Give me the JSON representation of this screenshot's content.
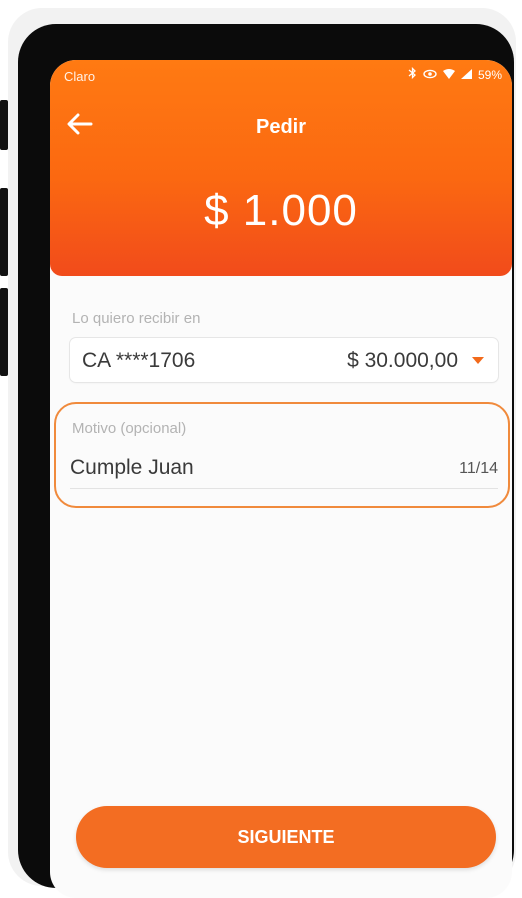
{
  "status_bar": {
    "carrier": "Claro",
    "icons": [
      "bluetooth-icon",
      "eye-icon",
      "wifi-icon",
      "signal-icon"
    ],
    "battery": "59%"
  },
  "header": {
    "title": "Pedir",
    "amount": "$ 1.000",
    "back_icon": "arrow-left-icon"
  },
  "account": {
    "label": "Lo quiero recibir en",
    "name": "CA ****1706",
    "balance": "$ 30.000,00"
  },
  "motivo": {
    "label": "Motivo (opcional)",
    "value": "Cumple Juan",
    "counter": "11/14"
  },
  "next_button": {
    "label": "SIGUIENTE"
  },
  "colors": {
    "primary": "#f36d22",
    "header_top": "#ff7a12",
    "header_bottom": "#f14b1b",
    "highlight_border": "#f08a3c"
  }
}
